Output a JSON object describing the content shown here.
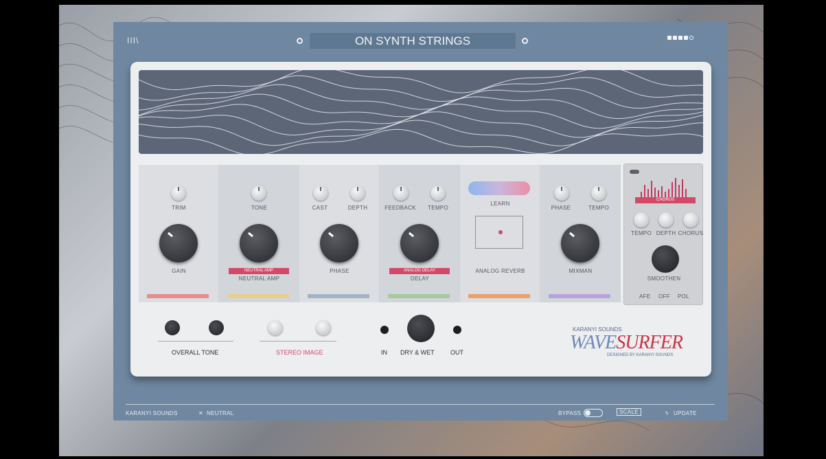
{
  "header": {
    "title": "ON SYNTH STRINGS",
    "menu_glyph": "III\\"
  },
  "modules": [
    {
      "top_label": "TRIM",
      "knob_label": "GAIN",
      "tag": "",
      "strip_color": "#e88d8b"
    },
    {
      "top_label": "TONE",
      "knob_label": "NEUTRAL AMP",
      "tag": "NEUTRAL AMP",
      "strip_color": "#e8cf8b"
    },
    {
      "top_label_a": "CAST",
      "top_label_b": "DEPTH",
      "knob_label": "PHASE",
      "tag": "",
      "strip_color": "#a3b3c7"
    },
    {
      "top_label_a": "FEEDBACK",
      "top_label_b": "TEMPO",
      "knob_label": "DELAY",
      "tag": "ANALOG DELAY",
      "strip_color": "#a7c9a0"
    },
    {
      "top_label": "LEARN",
      "knob_label": "ANALOG REVERB",
      "tag": "",
      "strip_color": "#eca06a"
    },
    {
      "top_label_a": "PHASE",
      "top_label_b": "TEMPO",
      "knob_label": "MIXMAN",
      "tag": "",
      "strip_color": "#b7a3e0"
    }
  ],
  "fx": {
    "tag": "CHORUS",
    "labels": [
      "TEMPO",
      "DEPTH",
      "CHORUS"
    ],
    "knob_label": "SMOOTHEN",
    "footer": [
      "AFE",
      "OFF",
      "POL"
    ]
  },
  "bottom": {
    "overall_tone": "OVERALL TONE",
    "stereo_image": "STEREO IMAGE",
    "in_label": "IN",
    "dry_wet": "DRY & WET",
    "out_label": "OUT"
  },
  "brand": {
    "maker": "KARANYI SOUNDS",
    "name_a": "WAVE",
    "name_b": "SURFER",
    "tagline": "DESIGNED BY KARANYI SOUNDS"
  },
  "footer": {
    "company": "KARANYI SOUNDS",
    "preset": "NEUTRAL",
    "bypass": "BYPASS",
    "scale": "SCALE",
    "update": "UPDATE"
  },
  "colors": {
    "accent": "#d24a68",
    "brand_blue": "#6f87b8",
    "brand_red": "#cc3344"
  }
}
